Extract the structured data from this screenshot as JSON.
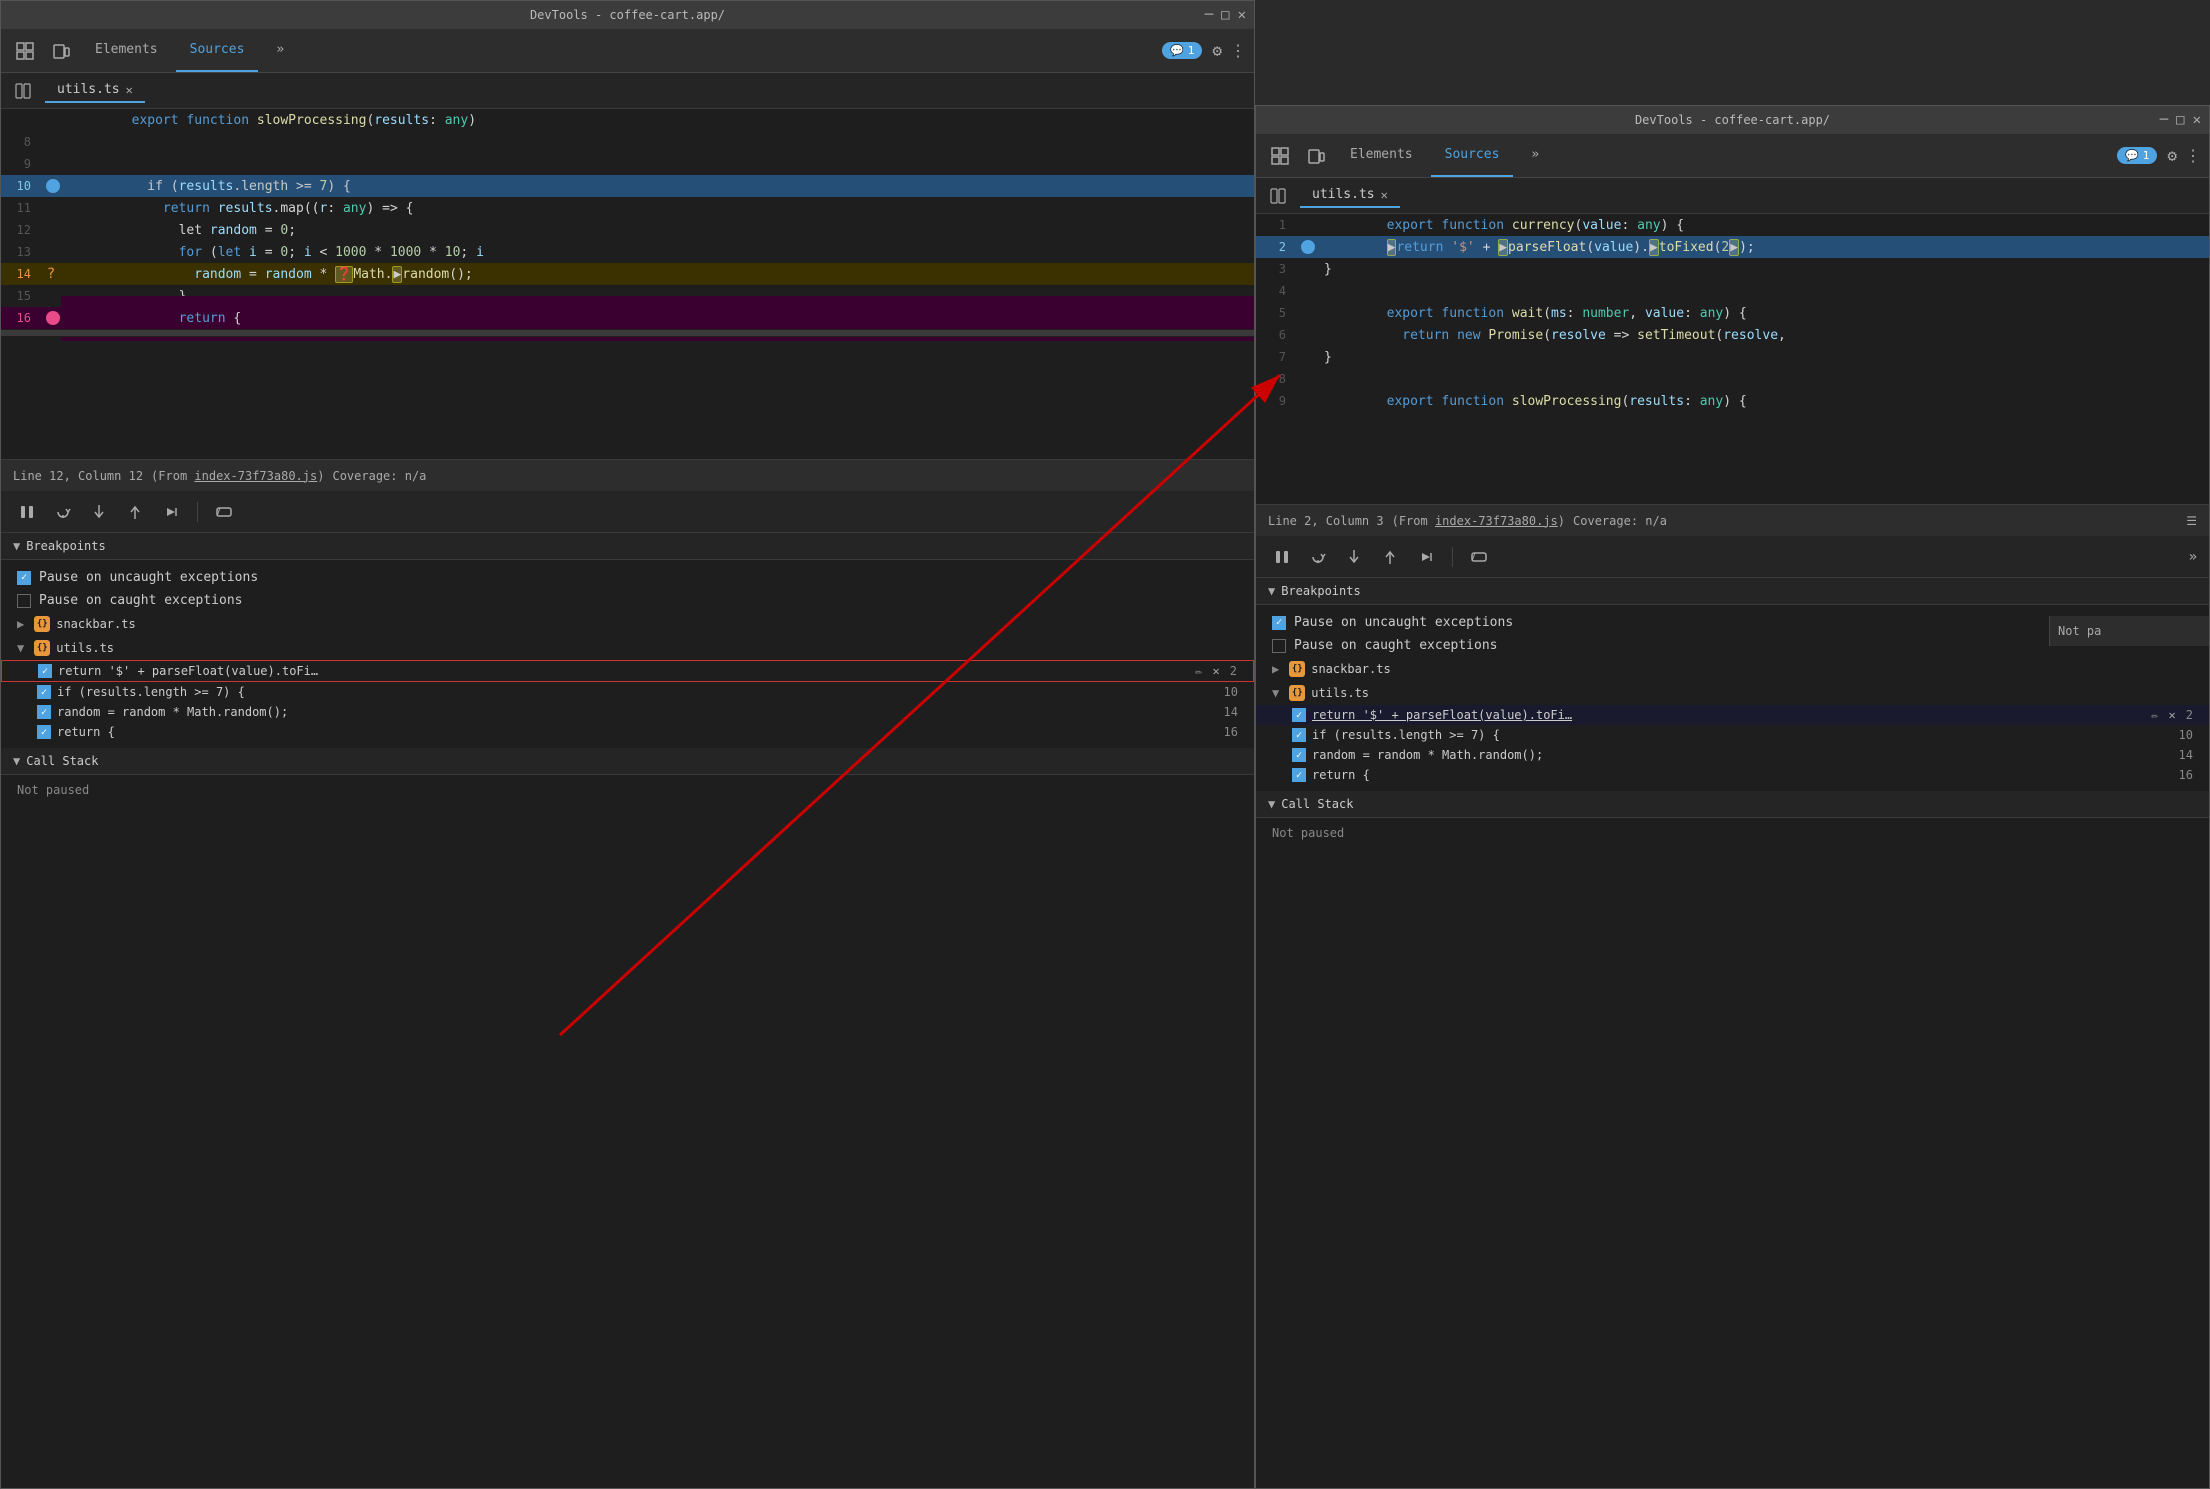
{
  "window1": {
    "titlebar": "DevTools - coffee-cart.app/",
    "tabs": {
      "elements": "Elements",
      "sources": "Sources",
      "more": "»",
      "badge": "1",
      "badge_icon": "💬"
    },
    "file_tab": "utils.ts",
    "status": {
      "position": "Line 12, Column 12",
      "from_text": "(From index-73f73a80.js)",
      "from_file": "index-73f73a80.js",
      "coverage": "Coverage: n/a"
    },
    "code_lines": [
      {
        "num": "8",
        "content": ""
      },
      {
        "num": "9",
        "content": ""
      },
      {
        "num": "10",
        "content": "  if (results.length >= 7) {",
        "highlight": "blue",
        "bp": "blue"
      },
      {
        "num": "11",
        "content": "    return results.map((r: any) => {"
      },
      {
        "num": "12",
        "content": "      let random = 0;"
      },
      {
        "num": "13",
        "content": "      for (let i = 0; i < 1000 * 1000 * 10; i"
      },
      {
        "num": "14",
        "content": "        random = random * ❓Math.▶random();",
        "highlight": "orange",
        "bp": "orange"
      },
      {
        "num": "15",
        "content": "      }"
      },
      {
        "num": "16",
        "content": "      return {",
        "highlight": "pink",
        "bp": "pink"
      }
    ],
    "export_fn_line": "export function slowProcessing(results: any)",
    "breakpoints": {
      "label": "Breakpoints",
      "pause_uncaught": "Pause on uncaught exceptions",
      "pause_caught": "Pause on caught exceptions",
      "snackbar_ts": "snackbar.ts",
      "utils_ts": "utils.ts",
      "bp1_code": "return '$' + parseFloat(value).toFi…",
      "bp1_line": "2",
      "bp2_code": "if (results.length >= 7) {",
      "bp2_line": "10",
      "bp3_code": "random = random * Math.random();",
      "bp3_line": "14",
      "bp4_code": "return {",
      "bp4_line": "16"
    },
    "call_stack": {
      "label": "Call Stack",
      "status": "Not paused"
    },
    "debug_toolbar": {
      "pause": "⏸",
      "step_over": "↷",
      "step_into": "↓",
      "step_out": "↑",
      "continue": "→→",
      "deactivate": "⊘"
    }
  },
  "window2": {
    "titlebar": "DevTools - coffee-cart.app/",
    "tabs": {
      "elements": "Elements",
      "sources": "Sources",
      "more": "»",
      "badge": "1",
      "badge_icon": "💬"
    },
    "file_tab": "utils.ts",
    "status": {
      "position": "Line 2, Column 3",
      "from_text": "(From index-73f73a80.js)",
      "from_file": "index-73f73a80.js",
      "coverage": "Coverage: n/a"
    },
    "code_lines": [
      {
        "num": "1",
        "content": "export function currency(value: any) {"
      },
      {
        "num": "2",
        "content": "  ▶return '$' + ▶parseFloat(value).▶toFixed(2▶);",
        "highlight": "blue",
        "bp": "blue"
      },
      {
        "num": "3",
        "content": "}"
      },
      {
        "num": "4",
        "content": ""
      },
      {
        "num": "5",
        "content": "export function wait(ms: number, value: any) {"
      },
      {
        "num": "6",
        "content": "  return new Promise(resolve => setTimeout(resolve,"
      },
      {
        "num": "7",
        "content": "}"
      },
      {
        "num": "8",
        "content": ""
      },
      {
        "num": "9",
        "content": "export function slowProcessing(results: any) {"
      }
    ],
    "breakpoints": {
      "label": "Breakpoints",
      "pause_uncaught": "Pause on uncaught exceptions",
      "pause_caught": "Pause on caught exceptions",
      "snackbar_ts": "snackbar.ts",
      "utils_ts": "utils.ts",
      "bp1_code": "return '$' + parseFloat(value).toFi…",
      "bp1_line": "2",
      "bp2_code": "if (results.length >= 7) {",
      "bp2_line": "10",
      "bp3_code": "random = random * Math.random();",
      "bp3_line": "14",
      "bp4_code": "return {",
      "bp4_line": "16"
    },
    "call_stack": {
      "label": "Call Stack",
      "status": "Not paused"
    },
    "not_paused": "Not pa",
    "debug_toolbar": {
      "pause": "⏸",
      "step_over": "↷",
      "step_into": "↓",
      "step_out": "↑",
      "continue": "→→",
      "deactivate": "⊘",
      "more": "»"
    }
  }
}
